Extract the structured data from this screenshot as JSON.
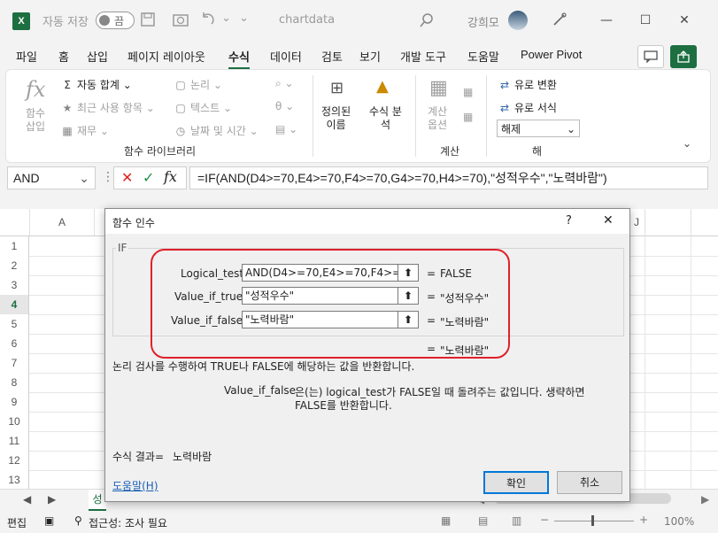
{
  "titlebar": {
    "autosave_label": "자동 저장",
    "autosave_state": "끔",
    "filename": "chartdata",
    "dropdown_glyph": "⌄",
    "user": "강희모"
  },
  "menu": [
    "파일",
    "홈",
    "삽입",
    "페이지 레이아웃",
    "수식",
    "데이터",
    "검토",
    "보기",
    "개발 도구",
    "도움말",
    "Power Pivot"
  ],
  "ribbon": {
    "insert_function": "함수\n삽입",
    "autosum": "자동 합계",
    "recent": "최근 사용 항목",
    "financial": "재무",
    "logical": "논리",
    "text": "텍스트",
    "datetime": "날짜 및 시간",
    "library_group": "함수 라이브러리",
    "defined_names": "정의된\n이름",
    "formula_auditing": "수식 분\n석",
    "calc_options": "계산\n옵션",
    "calc_group": "계산",
    "euro_convert": "유로 변환",
    "euro_format": "유로 서식",
    "dissolve": "해제",
    "solution_group": "해"
  },
  "namebox": "AND",
  "formula": "=IF(AND(D4>=70,E4>=70,F4>=70,G4>=70,H4>=70),\"성적우수\",\"노력바람\")",
  "grid": {
    "col_a": "A",
    "col_j": "J",
    "rows": [
      "1",
      "2",
      "3",
      "4",
      "5",
      "6",
      "7",
      "8",
      "9",
      "10",
      "11",
      "12",
      "13"
    ],
    "sheet_tab_partial": "성"
  },
  "dialog": {
    "title": "함수 인수",
    "help_glyph": "?",
    "close_glyph": "✕",
    "function": "IF",
    "args": [
      {
        "name": "Logical_test",
        "value": "AND(D4>=70,E4>=70,F4>=70",
        "result": "FALSE"
      },
      {
        "name": "Value_if_true",
        "value": "\"성적우수\"",
        "result": "\"성적우수\""
      },
      {
        "name": "Value_if_false",
        "value": "\"노력바람\"",
        "result": "\"노력바람\""
      }
    ],
    "equals": "=",
    "overall_result": "\"노력바람\"",
    "description": "논리 검사를 수행하여 TRUE나 FALSE에 해당하는 값을 반환합니다.",
    "arg_desc_name": "Value_if_false",
    "arg_desc_line1": "은(는) logical_test가 FALSE일 때 돌려주는 값입니다. 생략하면",
    "arg_desc_line2": "FALSE를 반환합니다.",
    "formula_result_label": "수식 결과=",
    "formula_result_value": "노력바람",
    "help_link": "도움말(H)",
    "ok": "확인",
    "cancel": "취소"
  },
  "status": {
    "mode": "편집",
    "accessibility": "접근성: 조사 필요",
    "zoom": "100%"
  },
  "colors": {
    "accent": "#1d6f42",
    "highlight": "#e0202a",
    "link": "#1a5fb4"
  }
}
